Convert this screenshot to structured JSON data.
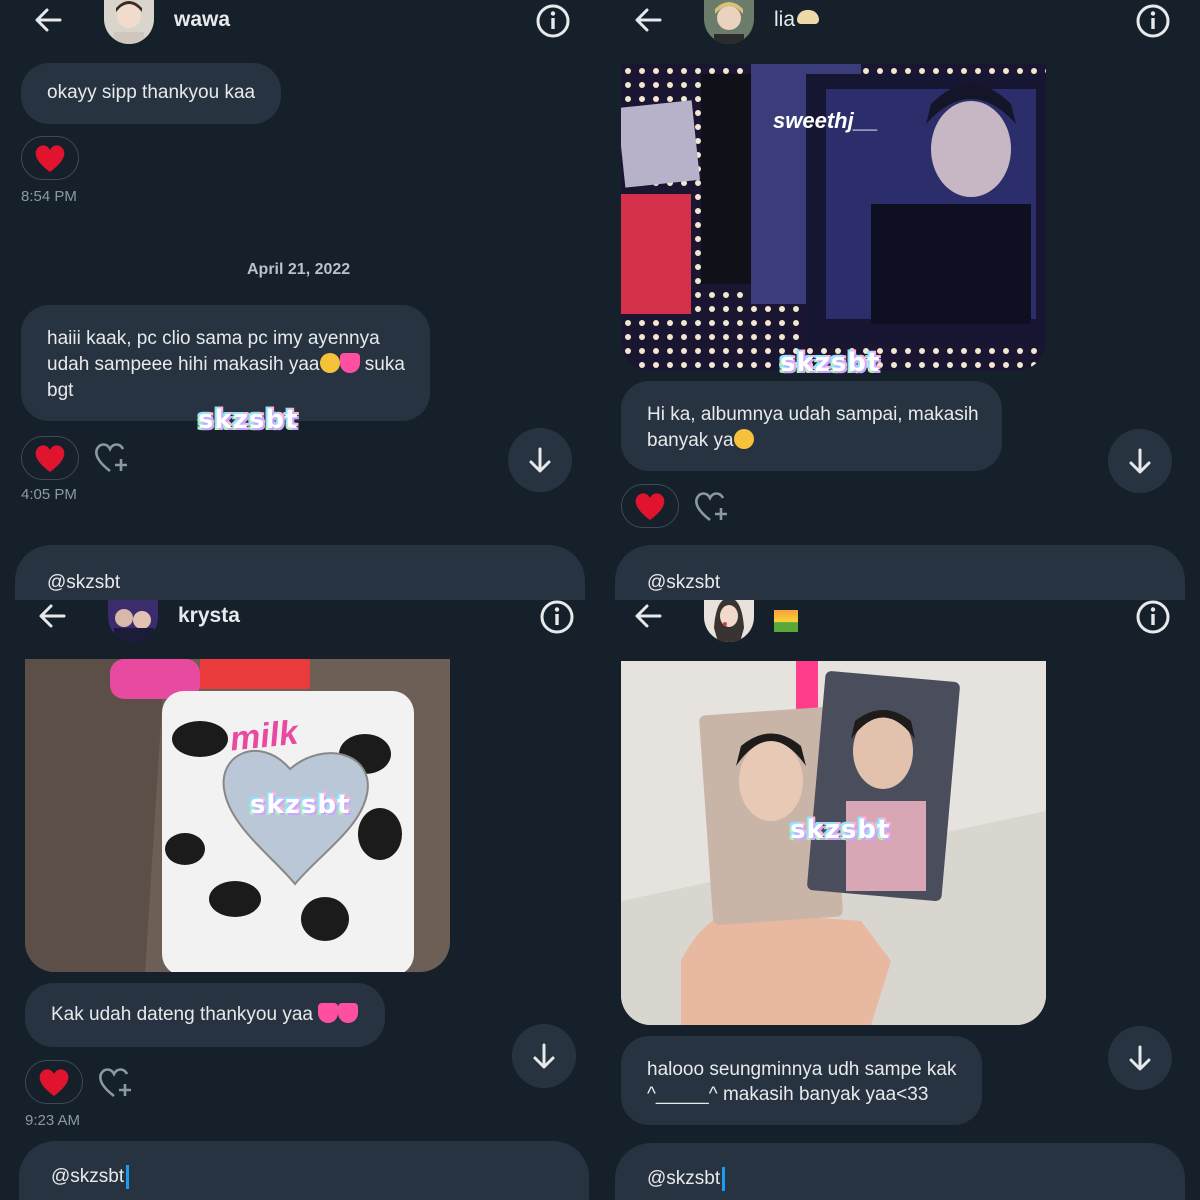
{
  "watermark": "skzsbt",
  "colors": {
    "background": "#15202b",
    "bubble": "#273340",
    "heart": "#e0142f",
    "accent": "#1d9bf0",
    "muted": "#8b98a5"
  },
  "panels": [
    {
      "username": "wawa",
      "icons": {
        "back": "arrow-left-icon",
        "info": "info-icon"
      },
      "message1": "okayy sipp thankyou kaa",
      "time1": "8:54 PM",
      "date": "April 21, 2022",
      "message2_line1": "haiii kaak, pc clio sama pc imy ayennya",
      "message2_line2a": "udah sampeee hihi makasih yaa",
      "message2_line2b": "suka",
      "message2_line3": "bgt",
      "time2": "4:05 PM",
      "composer": "@skzsbt"
    },
    {
      "username": "lia",
      "photo_caption": "sweethj__",
      "message_line1": "Hi ka, albumnya udah sampai, makasih",
      "message_line2": "banyak ya",
      "composer": "@skzsbt"
    },
    {
      "username": "krysta",
      "photo_text": "milk",
      "message": "Kak udah dateng thankyou yaa",
      "time": "9:23 AM",
      "composer": "@skzsbt"
    },
    {
      "username": "",
      "message_line1": "halooo seungminnya udh sampe kak",
      "message_line2": "^_____^ makasih banyak yaa<33",
      "composer": "@skzsbt"
    }
  ]
}
